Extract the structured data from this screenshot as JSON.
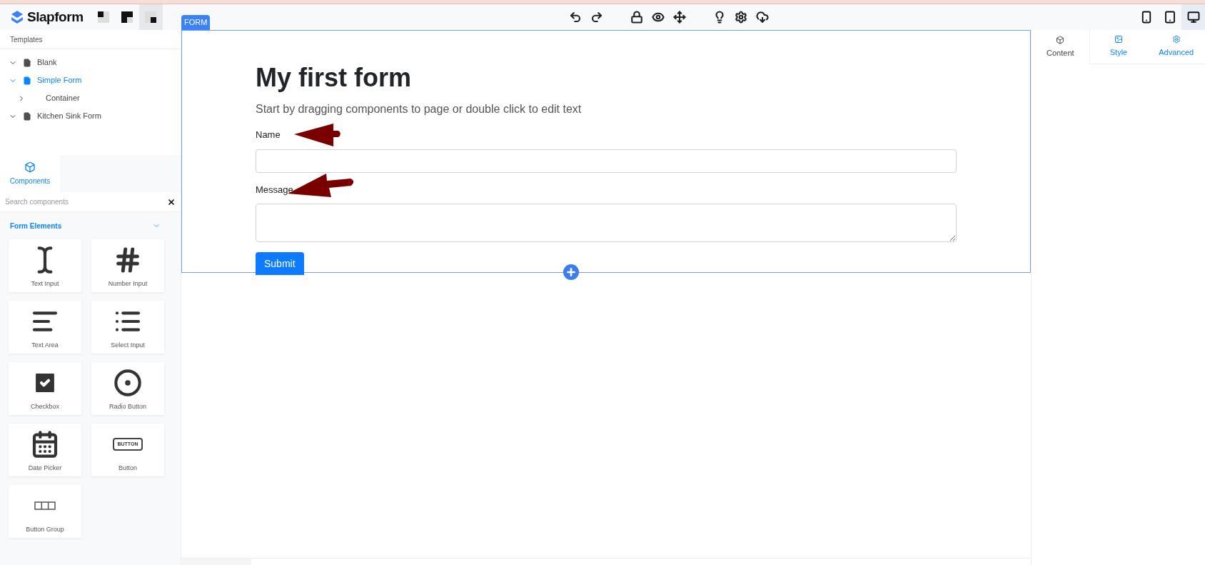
{
  "brand": {
    "name": "Slapform"
  },
  "layout_buttons": [
    {
      "selected": false
    },
    {
      "selected": false
    },
    {
      "selected": true
    }
  ],
  "device_buttons": [
    {
      "selected": false
    },
    {
      "selected": false
    },
    {
      "selected": true
    }
  ],
  "templates": {
    "title": "Templates",
    "items": [
      {
        "label": "Blank",
        "expanded": true,
        "selected": false
      },
      {
        "label": "Simple Form",
        "expanded": true,
        "selected": true,
        "children": [
          {
            "label": "Container",
            "expanded": false,
            "selected": false
          }
        ]
      },
      {
        "label": "Kitchen Sink Form",
        "expanded": true,
        "selected": false
      }
    ]
  },
  "components_tab": {
    "label": "Components",
    "selected": true
  },
  "search": {
    "placeholder": "Search components"
  },
  "section": {
    "title": "Form Elements",
    "expanded": true
  },
  "components": [
    {
      "label": "Text Input"
    },
    {
      "label": "Number Input"
    },
    {
      "label": "Text Area"
    },
    {
      "label": "Select Input"
    },
    {
      "label": "Checkbox"
    },
    {
      "label": "Radio Button"
    },
    {
      "label": "Date Picker"
    },
    {
      "label": "Button"
    },
    {
      "label": "Button Group"
    }
  ],
  "button_icon_text": "BUTTON",
  "canvas": {
    "badge": "FORM",
    "title": "My first form",
    "subtitle": "Start by dragging components to page or double click to edit text",
    "fields": [
      {
        "kind": "input",
        "label": "Name"
      },
      {
        "kind": "textarea",
        "label": "Message"
      }
    ],
    "submit": "Submit"
  },
  "right_tabs": [
    {
      "label": "Content",
      "selected": true
    },
    {
      "label": "Style",
      "selected": false
    },
    {
      "label": "Advanced",
      "selected": false
    }
  ]
}
